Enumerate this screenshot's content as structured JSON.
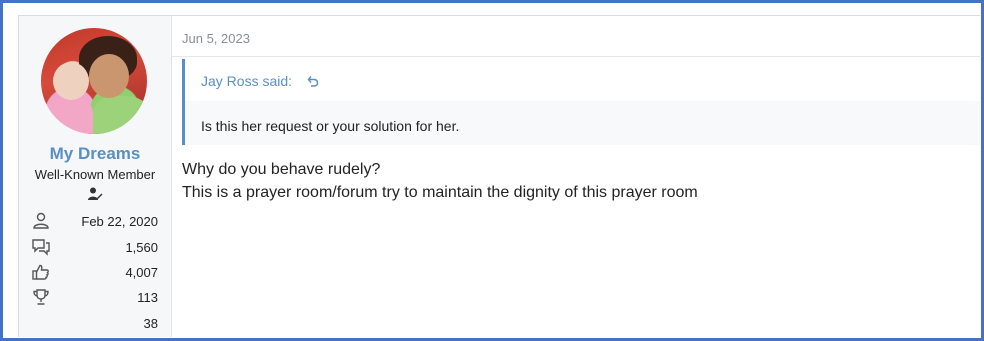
{
  "post": {
    "date": "Jun 5, 2023",
    "quote": {
      "author_label": "Jay Ross said:",
      "text": "Is this her request or your solution for her."
    },
    "message_lines": [
      "Why do you behave rudely?",
      "This is a prayer room/forum try to maintain the dignity of this prayer room"
    ]
  },
  "user": {
    "name": "My Dreams",
    "title": "Well-Known Member",
    "stats": {
      "joined": "Feb 22, 2020",
      "messages": "1,560",
      "reactions": "4,007",
      "points": "113",
      "extra": "38"
    }
  },
  "colors": {
    "frame": "#4472c4",
    "link": "#5a8fc5",
    "sidebar_bg": "#f5f7f9"
  },
  "icons": {
    "joined": "user-icon",
    "messages": "speech-bubbles-icon",
    "reactions": "thumbs-up-icon",
    "points": "trophy-icon",
    "banner": "user-edit-icon",
    "quote_jump": "return-arrow-icon"
  }
}
